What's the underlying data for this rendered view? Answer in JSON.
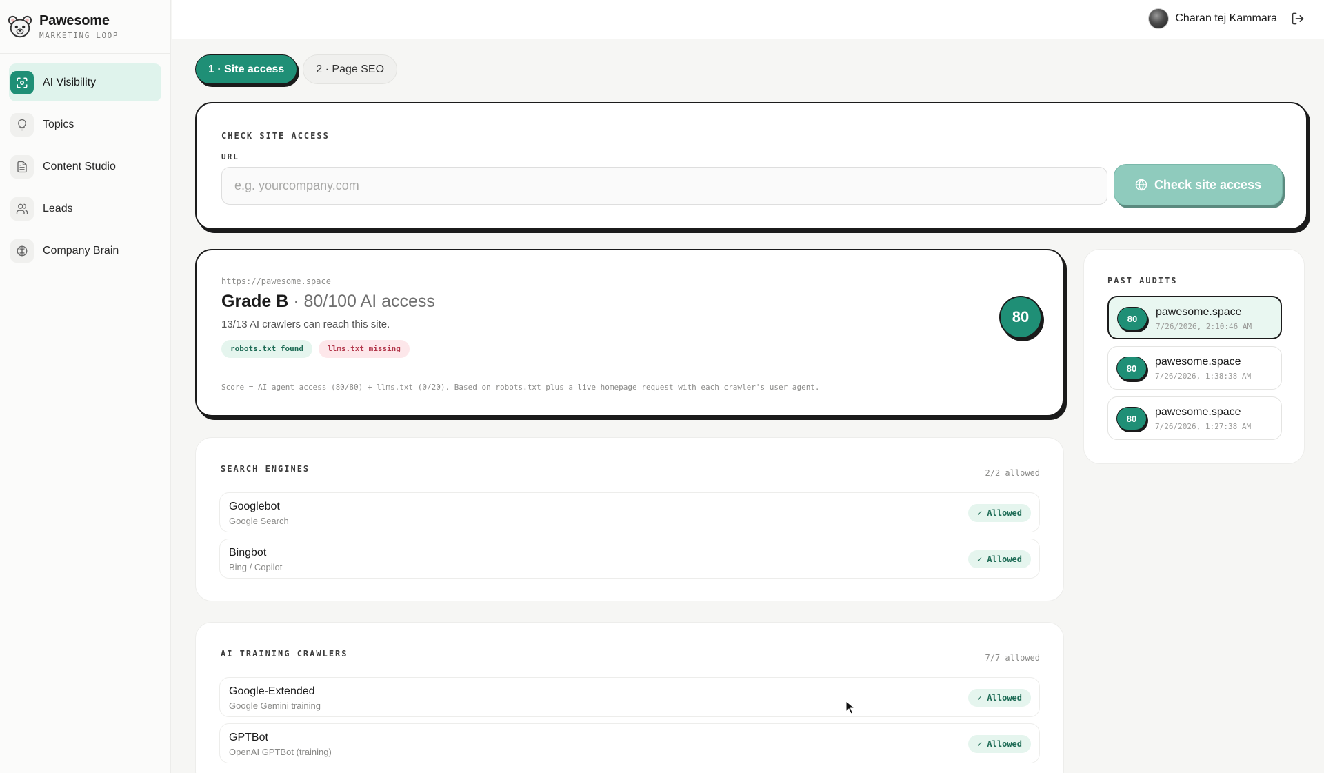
{
  "brand": {
    "name": "Pawesome",
    "subtitle": "MARKETING LOOP"
  },
  "sidebar": {
    "items": [
      {
        "label": "AI Visibility",
        "icon": "scan-face-icon",
        "active": true
      },
      {
        "label": "Topics",
        "icon": "lightbulb-icon"
      },
      {
        "label": "Content Studio",
        "icon": "document-icon"
      },
      {
        "label": "Leads",
        "icon": "users-icon"
      },
      {
        "label": "Company Brain",
        "icon": "brain-icon"
      }
    ]
  },
  "header": {
    "user_name": "Charan tej Kammara",
    "logout_icon": "logout-icon"
  },
  "steps": [
    {
      "label": "1 · Site access"
    },
    {
      "label": "2 · Page SEO"
    }
  ],
  "check": {
    "section_label": "CHECK SITE ACCESS",
    "url_label": "URL",
    "url_placeholder": "e.g. yourcompany.com",
    "url_value": "",
    "button_label": "Check site access"
  },
  "result": {
    "url": "https://pawesome.space",
    "grade": "Grade B",
    "score_text": " · 80/100 AI access",
    "summary": "13/13 AI crawlers can reach this site.",
    "badges": {
      "robots": "robots.txt found",
      "llms": "llms.txt missing"
    },
    "score": "80",
    "footnote": "Score = AI agent access (80/80) + llms.txt (0/20). Based on robots.txt plus a live homepage request with each crawler's user agent."
  },
  "search_engines": {
    "label": "SEARCH ENGINES",
    "count": "2/2 allowed",
    "rows": [
      {
        "name": "Googlebot",
        "desc": "Google Search",
        "status": "Allowed"
      },
      {
        "name": "Bingbot",
        "desc": "Bing / Copilot",
        "status": "Allowed"
      }
    ]
  },
  "training_crawlers": {
    "label": "AI TRAINING CRAWLERS",
    "count": "7/7 allowed",
    "rows": [
      {
        "name": "Google-Extended",
        "desc": "Google Gemini training",
        "status": "Allowed"
      },
      {
        "name": "GPTBot",
        "desc": "OpenAI GPTBot (training)",
        "status": "Allowed"
      }
    ]
  },
  "past_audits": {
    "label": "PAST AUDITS",
    "items": [
      {
        "score": "80",
        "domain": "pawesome.space",
        "time": "7/26/2026, 2:10:46 AM"
      },
      {
        "score": "80",
        "domain": "pawesome.space",
        "time": "7/26/2026, 1:38:38 AM"
      },
      {
        "score": "80",
        "domain": "pawesome.space",
        "time": "7/26/2026, 1:27:38 AM"
      }
    ]
  },
  "colors": {
    "accent": "#1f8f76",
    "accent_light": "#dff3ec",
    "danger_bg": "#fde7ea",
    "danger_text": "#b2364a"
  }
}
